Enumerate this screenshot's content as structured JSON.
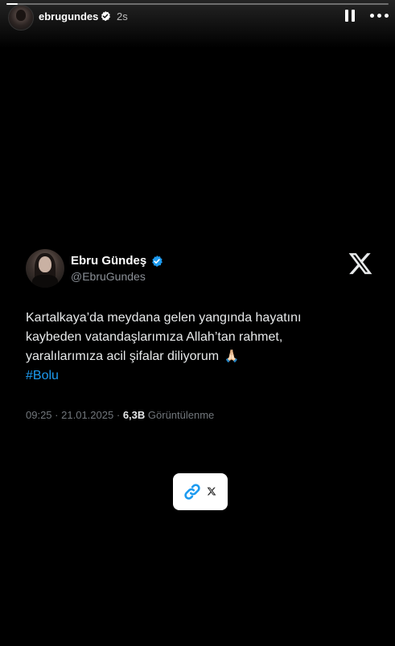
{
  "story": {
    "username": "ebrugundes",
    "time": "2s",
    "progress": 0.03,
    "icons": {
      "avatar": "profile-avatar-icon",
      "verified": "verified-badge-icon",
      "pause": "pause-icon",
      "more": "more-options-icon"
    }
  },
  "tweet": {
    "display_name": "Ebru Gündeş",
    "handle": "@EbruGundes",
    "text_lines": [
      "Kartalkaya’da meydana gelen yangında hayatını",
      "kaybeden vatandaşlarımıza Allah’tan rahmet,",
      "yaralılarımıza acil şifalar diliyorum"
    ],
    "emoji": "🙏🏻",
    "hashtag": "#Bolu",
    "time": "09:25",
    "date": "21.01.2025",
    "separator": "·",
    "views_count": "6,3B",
    "views_label": "Görüntülenme",
    "colors": {
      "hashtag": "#1d9bf0",
      "verified": "#1d9bf0",
      "meta": "#71767b"
    }
  },
  "link_sticker": {
    "link_icon": "link-icon",
    "platform_icon": "x-logo-icon",
    "link_color": "#1d9bf0"
  }
}
